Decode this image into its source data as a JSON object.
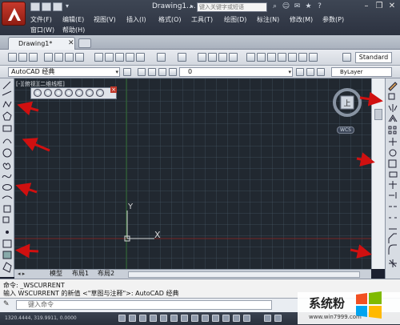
{
  "window": {
    "doc_title": "Drawing1....",
    "search_placeholder": "键入关键字或短语",
    "menu_row1": [
      "文件(F)",
      "编辑(E)",
      "视图(V)",
      "插入(I)",
      "格式(O)",
      "工具(T)",
      "绘图(D)",
      "标注(N)",
      "修改(M)",
      "参数(P)"
    ],
    "menu_row2": [
      "窗口(W)",
      "帮助(H)"
    ]
  },
  "tabs": {
    "doc_tab": "Drawing1*"
  },
  "toolbar": {
    "text_style": "Standard",
    "workspace": "AutoCAD 经典",
    "layer": "0",
    "linetype": "ByLayer"
  },
  "viewport": {
    "label": "[-][俯视][二维线框]",
    "y_axis": "Y",
    "x_axis": "X",
    "viewcube_face": "上",
    "wcs_label": "WCS"
  },
  "layout_tabs": [
    "模型",
    "布局1",
    "布局2"
  ],
  "command": {
    "history": [
      "命令:  _WSCURRENT",
      "输入 WSCURRENT 的新值 <\"草图与注释\">: AutoCAD 经典"
    ],
    "prompt": "键入命令"
  },
  "status": {
    "coords": "1320.4444, 319.9911, 0.0000"
  },
  "watermark": {
    "brand": "系统粉",
    "url": "www.win7999.com"
  },
  "colors": {
    "arrow": "#d01010",
    "canvas": "#212830",
    "app_red": "#c73a2c"
  },
  "icons": {
    "left_toolbar": [
      "line-icon",
      "construction-line-icon",
      "polyline-icon",
      "polygon-icon",
      "rectangle-icon",
      "arc-icon",
      "circle-icon",
      "revision-cloud-icon",
      "spline-icon",
      "ellipse-icon",
      "ellipse-arc-icon",
      "insert-block-icon",
      "make-block-icon",
      "point-icon",
      "hatch-icon",
      "gradient-icon",
      "region-icon",
      "table-icon",
      "mtext-icon"
    ],
    "right_toolbar": [
      "erase-icon",
      "copy-icon",
      "mirror-icon",
      "offset-icon",
      "array-icon",
      "move-icon",
      "rotate-icon",
      "scale-icon",
      "stretch-icon",
      "trim-icon",
      "extend-icon",
      "break-at-point-icon",
      "break-icon",
      "join-icon",
      "chamfer-icon",
      "fillet-icon",
      "explode-icon"
    ]
  }
}
